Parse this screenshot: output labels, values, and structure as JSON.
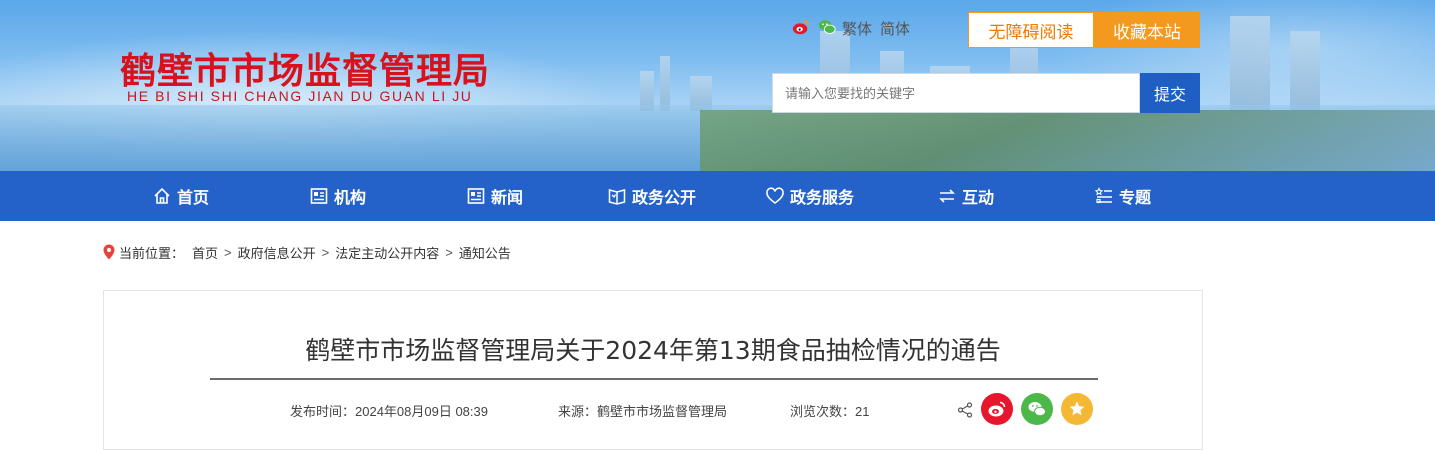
{
  "header": {
    "logo_cn": "鹤壁市市场监督管理局",
    "logo_en": "HE BI SHI SHI CHANG JIAN DU GUAN LI JU",
    "lang_traditional": "繁体",
    "lang_simplified": "简体",
    "accessible_label": "无障碍阅读",
    "favorite_label": "收藏本站",
    "search_placeholder": "请输入您要找的关键字",
    "search_button": "提交"
  },
  "nav": {
    "items": [
      {
        "label": "首页",
        "icon": "home-icon"
      },
      {
        "label": "机构",
        "icon": "org-icon"
      },
      {
        "label": "新闻",
        "icon": "news-icon"
      },
      {
        "label": "政务公开",
        "icon": "open-gov-icon"
      },
      {
        "label": "政务服务",
        "icon": "heart-icon"
      },
      {
        "label": "互动",
        "icon": "exchange-icon"
      },
      {
        "label": "专题",
        "icon": "topic-icon"
      }
    ]
  },
  "breadcrumb": {
    "prefix": "当前位置：",
    "items": [
      "首页",
      "政府信息公开",
      "法定主动公开内容",
      "通知公告"
    ]
  },
  "article": {
    "title": "鹤壁市市场监督管理局关于2024年第13期食品抽检情况的通告",
    "publish_time": "发布时间：2024年08月09日 08:39",
    "source": "来源：鹤壁市市场监督管理局",
    "views": "浏览次数：21"
  },
  "colors": {
    "nav_bg": "#2462c9",
    "logo_red": "#d8121c",
    "orange": "#f39a1e",
    "weibo_red": "#e6162d",
    "wechat_green": "#4cb848",
    "fav_yellow": "#f5b834"
  }
}
